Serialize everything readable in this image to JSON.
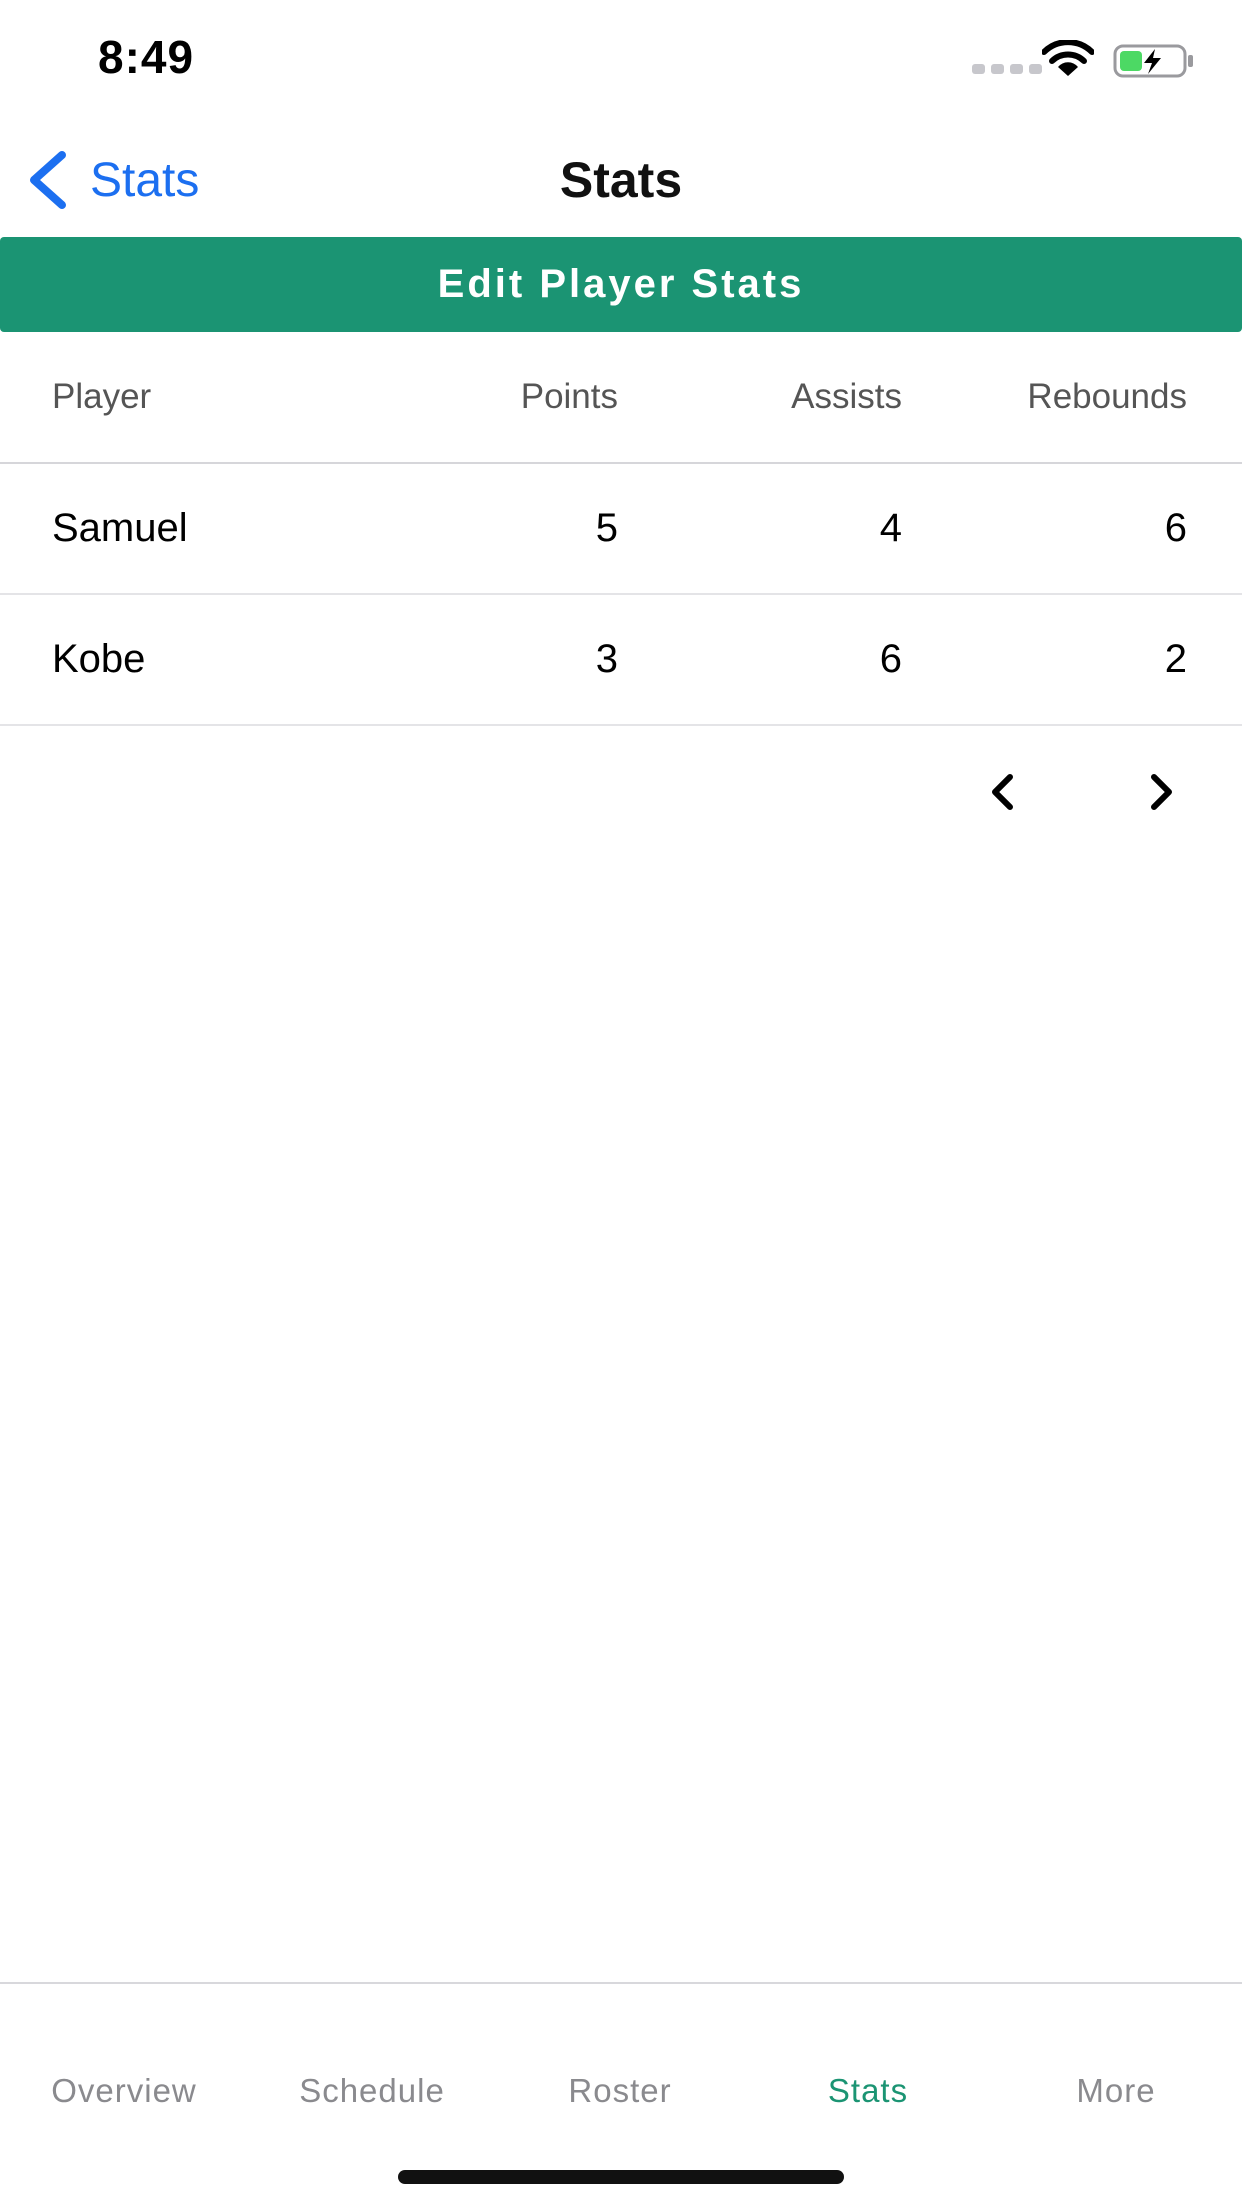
{
  "status_bar": {
    "time": "8:49"
  },
  "nav": {
    "back_label": "Stats",
    "title": "Stats"
  },
  "edit_button_label": "Edit Player Stats",
  "table": {
    "columns": [
      "Player",
      "Points",
      "Assists",
      "Rebounds"
    ],
    "rows": [
      [
        "Samuel",
        "5",
        "4",
        "6"
      ],
      [
        "Kobe",
        "3",
        "6",
        "2"
      ]
    ]
  },
  "tabs": [
    {
      "label": "Overview",
      "active": false
    },
    {
      "label": "Schedule",
      "active": false
    },
    {
      "label": "Roster",
      "active": false
    },
    {
      "label": "Stats",
      "active": true
    },
    {
      "label": "More",
      "active": false
    }
  ],
  "colors": {
    "accent": "#1b9473",
    "link": "#1c6ff0",
    "battery_fill": "#4cd964"
  },
  "icons": [
    "cellular-signal-icon",
    "wifi-icon",
    "battery-charging-icon",
    "chevron-left-icon",
    "chevron-right-icon"
  ]
}
